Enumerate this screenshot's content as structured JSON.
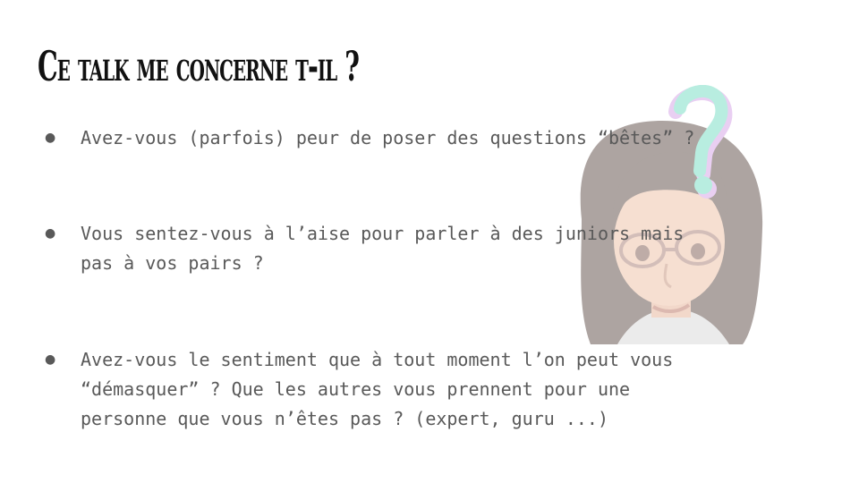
{
  "slide": {
    "title": "Ce talk me concerne t-il ?",
    "bullets": [
      {
        "marker": "●",
        "text": "Avez-vous (parfois) peur de poser des questions “bêtes” ?"
      },
      {
        "marker": "●",
        "text": "Vous sentez-vous à l’aise pour parler à des juniors mais\npas à vos pairs ?"
      },
      {
        "marker": "●",
        "text": "Avez-vous le sentiment que à tout moment l’on peut vous\n“démasquer” ? Que les autres vous prennent pour une\npersonne que vous n’êtes pas ? (expert, guru ...)"
      }
    ],
    "illustration": {
      "icon": "avatar-with-question-mark-icon",
      "question_mark_colors": [
        "#7fe0c8",
        "#d8a8e8"
      ]
    }
  }
}
